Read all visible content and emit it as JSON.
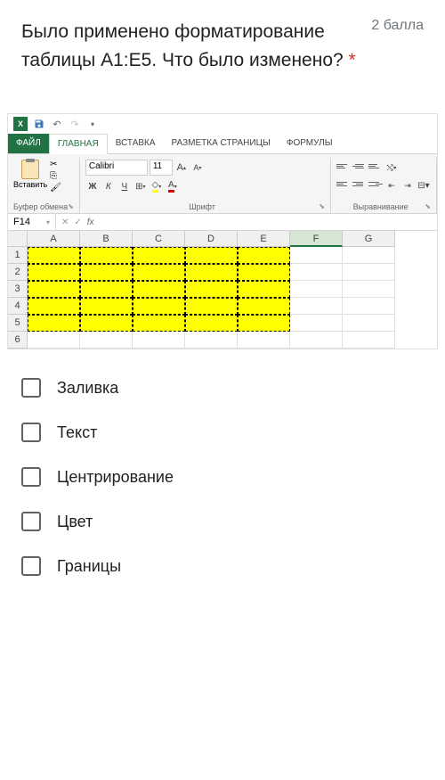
{
  "question": {
    "text": "Было применено форматирование таблицы A1:E5. Что было изменено?",
    "required_mark": "*",
    "points": "2 балла"
  },
  "excel": {
    "tabs": {
      "file": "ФАЙЛ",
      "home": "ГЛАВНАЯ",
      "insert": "ВСТАВКА",
      "pagelayout": "РАЗМЕТКА СТРАНИЦЫ",
      "formulas": "ФОРМУЛЫ"
    },
    "ribbon": {
      "paste_label": "Вставить",
      "clipboard_label": "Буфер обмена",
      "font_label": "Шрифт",
      "alignment_label": "Выравнивание",
      "font_name": "Calibri",
      "font_size": "11",
      "bold": "Ж",
      "italic": "К",
      "underline": "Ч",
      "increase_font": "A",
      "decrease_font": "A"
    },
    "namebox": "F14",
    "fx": "fx",
    "columns": [
      "A",
      "B",
      "C",
      "D",
      "E",
      "F",
      "G"
    ],
    "rows": [
      "1",
      "2",
      "3",
      "4",
      "5",
      "6"
    ],
    "selected_cell": {
      "row": 14,
      "col": "F"
    },
    "formatted_range": "A1:E5",
    "fill_color": "#ffff00"
  },
  "options": [
    {
      "label": "Заливка"
    },
    {
      "label": "Текст"
    },
    {
      "label": "Центрирование"
    },
    {
      "label": "Цвет"
    },
    {
      "label": "Границы"
    }
  ]
}
